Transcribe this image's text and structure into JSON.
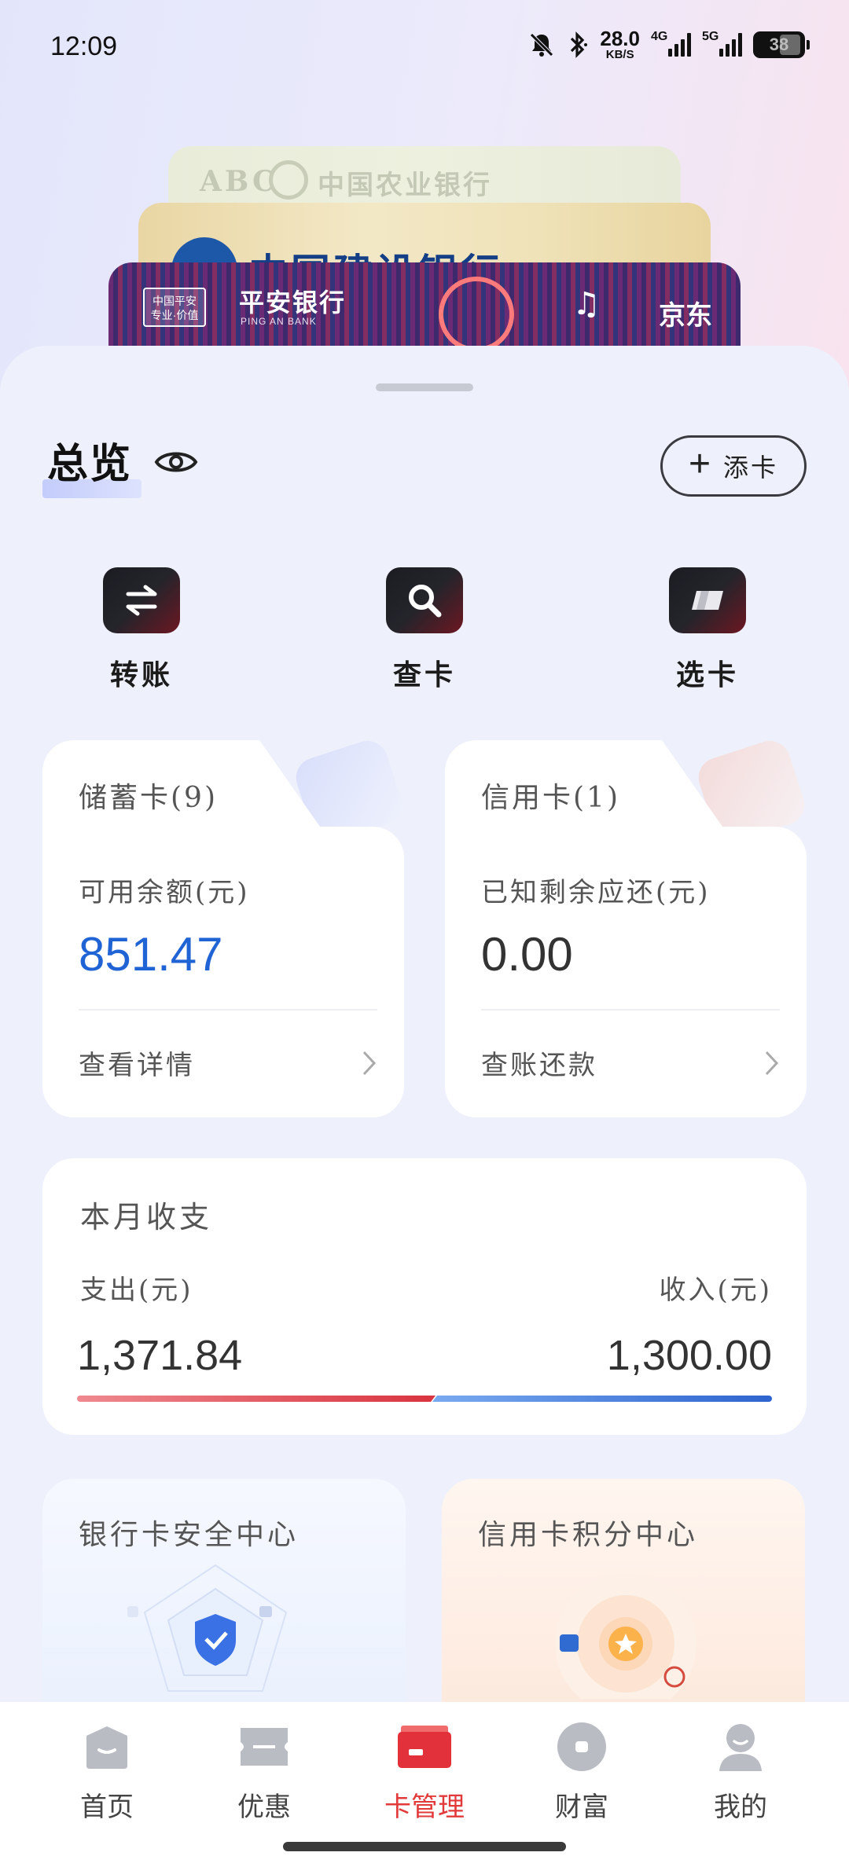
{
  "status_bar": {
    "time": "12:09",
    "net_speed_value": "28.0",
    "net_speed_unit": "KB/S",
    "network_1": "4G",
    "network_2": "5G",
    "battery": "38"
  },
  "card_stack": {
    "card_1": {
      "latin": "ABC",
      "name": "中国农业银行"
    },
    "card_2": {
      "name": "中国建设银行"
    },
    "card_3": {
      "badge_line1": "中国平安",
      "badge_line2": "专业·价值",
      "name": "平安银行",
      "name_en": "PING AN BANK",
      "brand": "京东"
    }
  },
  "overview": {
    "title": "总览",
    "add_card_label": "添卡"
  },
  "quick_actions": [
    {
      "label": "转账",
      "icon": "transfer-icon"
    },
    {
      "label": "查卡",
      "icon": "search-icon"
    },
    {
      "label": "选卡",
      "icon": "card-select-icon"
    }
  ],
  "debit_card": {
    "title": "储蓄卡(9)",
    "subtitle": "可用余额(元)",
    "amount": "851.47",
    "link": "查看详情",
    "accent": "#1f63d4"
  },
  "credit_card": {
    "title": "信用卡(1)",
    "subtitle": "已知剩余应还(元)",
    "amount": "0.00",
    "link": "查账还款"
  },
  "monthly": {
    "title": "本月收支",
    "expense_label": "支出(元)",
    "income_label": "收入(元)",
    "expense_value": "1,371.84",
    "income_value": "1,300.00",
    "expense_amount": 1371.84,
    "income_amount": 1300.0,
    "expense_color": "#d9343f",
    "income_color": "#2e64cf"
  },
  "features": {
    "security_title": "银行卡安全中心",
    "points_title": "信用卡积分中心"
  },
  "tab_bar": {
    "items": [
      {
        "label": "首页",
        "icon": "home-icon"
      },
      {
        "label": "优惠",
        "icon": "coupon-icon"
      },
      {
        "label": "卡管理",
        "icon": "card-manage-icon"
      },
      {
        "label": "财富",
        "icon": "wealth-icon"
      },
      {
        "label": "我的",
        "icon": "profile-icon"
      }
    ],
    "active_index": 2,
    "active_color": "#e23a3a"
  }
}
